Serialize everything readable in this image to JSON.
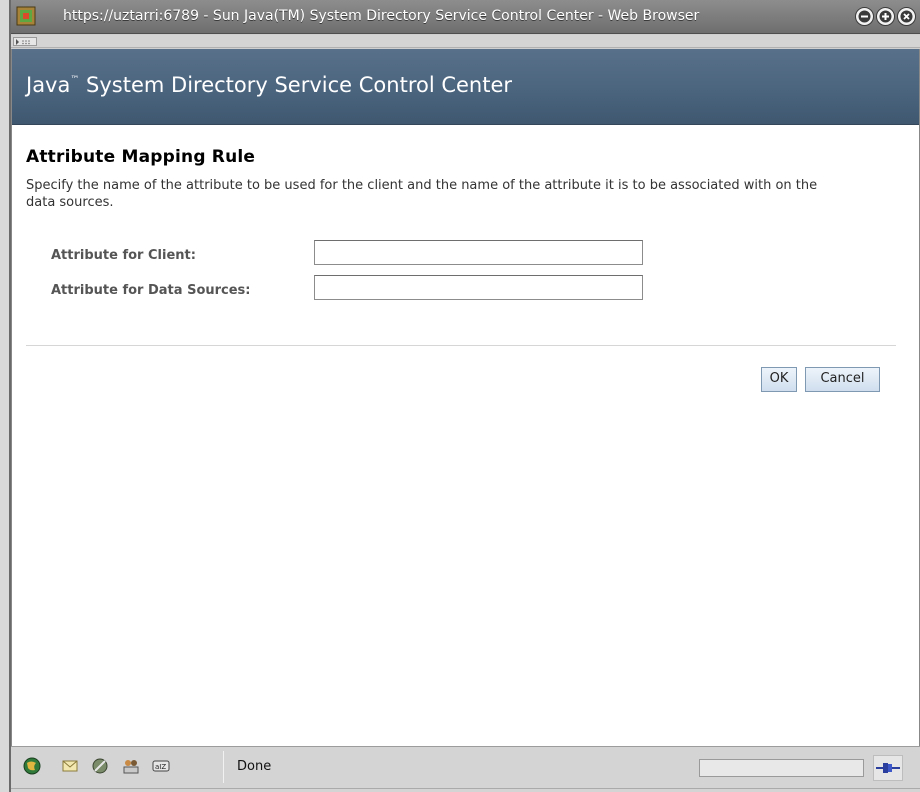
{
  "window": {
    "title": "https://uztarri:6789 - Sun Java(TM) System Directory Service Control Center - Web Browser",
    "buttons": [
      "minimize-icon",
      "maximize-icon",
      "close-icon"
    ]
  },
  "banner": {
    "title_prefix": "Java",
    "title_tm": "™",
    "title_rest": " System Directory Service Control Center"
  },
  "page": {
    "title": "Attribute Mapping Rule",
    "description": "Specify the name of the attribute to be used for the client and the name of the attribute it is to be associated with on the data sources."
  },
  "form": {
    "client_label": "Attribute for Client:",
    "client_value": "",
    "sources_label": "Attribute for Data Sources:",
    "sources_value": ""
  },
  "buttons": {
    "ok": "OK",
    "cancel": "Cancel"
  },
  "statusbar": {
    "icons": [
      "navigator-icon",
      "mail-icon",
      "composer-icon",
      "address-book-icon",
      "chat-icon"
    ],
    "status": "Done",
    "colors": {
      "accent": "#4d6680"
    }
  }
}
